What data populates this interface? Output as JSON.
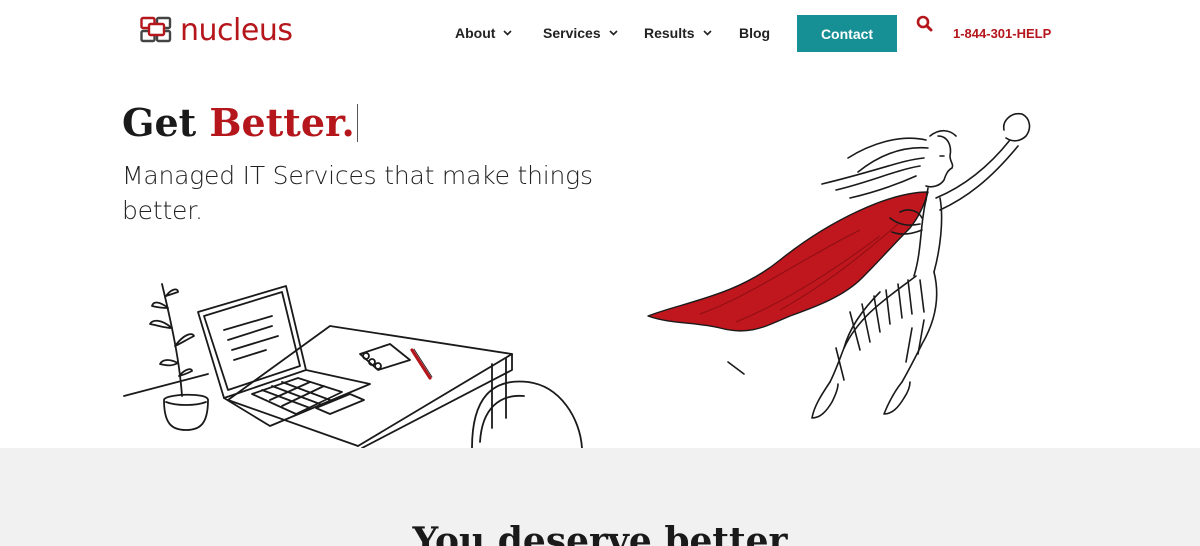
{
  "brand": {
    "name": "nucleus",
    "color": "#b4161b",
    "logo_icon": "nucleus-squares-icon"
  },
  "nav": {
    "items": [
      {
        "label": "About",
        "has_dropdown": true
      },
      {
        "label": "Services",
        "has_dropdown": true
      },
      {
        "label": "Results",
        "has_dropdown": true
      },
      {
        "label": "Blog",
        "has_dropdown": false
      }
    ],
    "contact_label": "Contact",
    "contact_color": "#168f95",
    "search_icon": "search-icon",
    "phone": "1-844-301-HELP"
  },
  "hero": {
    "title_prefix": "Get ",
    "title_accent": "Better.",
    "subtitle": "Managed IT Services that make things better.",
    "illustration_left": "desk-laptop-plant-illustration",
    "illustration_right": "superhero-woman-red-cape-illustration"
  },
  "section": {
    "title": "You deserve better"
  }
}
